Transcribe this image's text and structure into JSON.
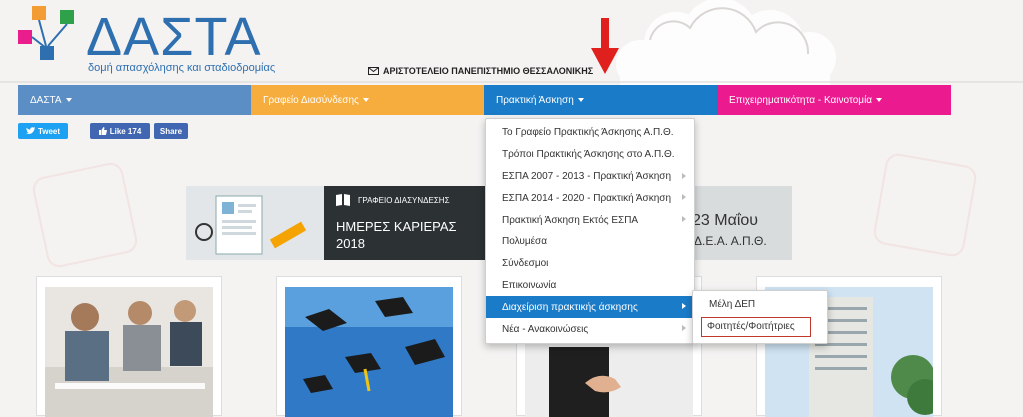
{
  "header": {
    "logo_text": "ΔΑΣΤΑ",
    "logo_tagline": "δομή απασχόλησης και σταδιοδρομίας",
    "university": "ΑΡΙΣΤΟΤΕΛΕΙΟ ΠΑΝΕΠΙΣΤΗΜΙΟ ΘΕΣΣΑΛΟΝΙΚΗΣ"
  },
  "nav": {
    "items": [
      {
        "label": "ΔΑΣΤΑ",
        "color": "#5b8ec4"
      },
      {
        "label": "Γραφείο Διασύνδεσης",
        "color": "#f6ad3d"
      },
      {
        "label": "Πρακτική Άσκηση",
        "color": "#1a7bc8"
      },
      {
        "label": "Επιχειρηματικότητα - Καινοτομία",
        "color": "#ec1a8f"
      }
    ]
  },
  "social": {
    "tweet": "Tweet",
    "like": "Like 174",
    "share": "Share"
  },
  "banner": {
    "office": "ΓΡΑΦΕΙΟ ΔΙΑΣΥΝΔΕΣΗΣ",
    "days": "ΗΜΕΡΕΣ ΚΑΡΙΕΡΑΣ",
    "year": "2018",
    "date": "23 Μαΐου",
    "venue": "Δ.Ε.Α. Α.Π.Θ."
  },
  "dropdown": {
    "items": [
      {
        "label": "Το Γραφείο Πρακτικής Άσκησης Α.Π.Θ.",
        "has_sub": false
      },
      {
        "label": "Τρόποι Πρακτικής Άσκησης στο Α.Π.Θ.",
        "has_sub": false
      },
      {
        "label": "ΕΣΠΑ 2007 - 2013 - Πρακτική Άσκηση",
        "has_sub": true
      },
      {
        "label": "ΕΣΠΑ 2014 - 2020 - Πρακτική Άσκηση",
        "has_sub": true
      },
      {
        "label": "Πρακτική Άσκηση Εκτός ΕΣΠΑ",
        "has_sub": true
      },
      {
        "label": "Πολυμέσα",
        "has_sub": false
      },
      {
        "label": "Σύνδεσμοι",
        "has_sub": false
      },
      {
        "label": "Επικοινωνία",
        "has_sub": false
      },
      {
        "label": "Διαχείριση πρακτικής άσκησης",
        "has_sub": true,
        "active": true
      },
      {
        "label": "Νέα - Ανακοινώσεις",
        "has_sub": true
      }
    ]
  },
  "submenu": {
    "items": [
      {
        "label": "Μέλη ΔΕΠ"
      },
      {
        "label": "Φοιτητές/Φοιτήτριες"
      }
    ],
    "highlight_color": "#c0392b"
  },
  "icons": {
    "arrow": "red-down-arrow-icon",
    "mail": "mail-icon"
  }
}
